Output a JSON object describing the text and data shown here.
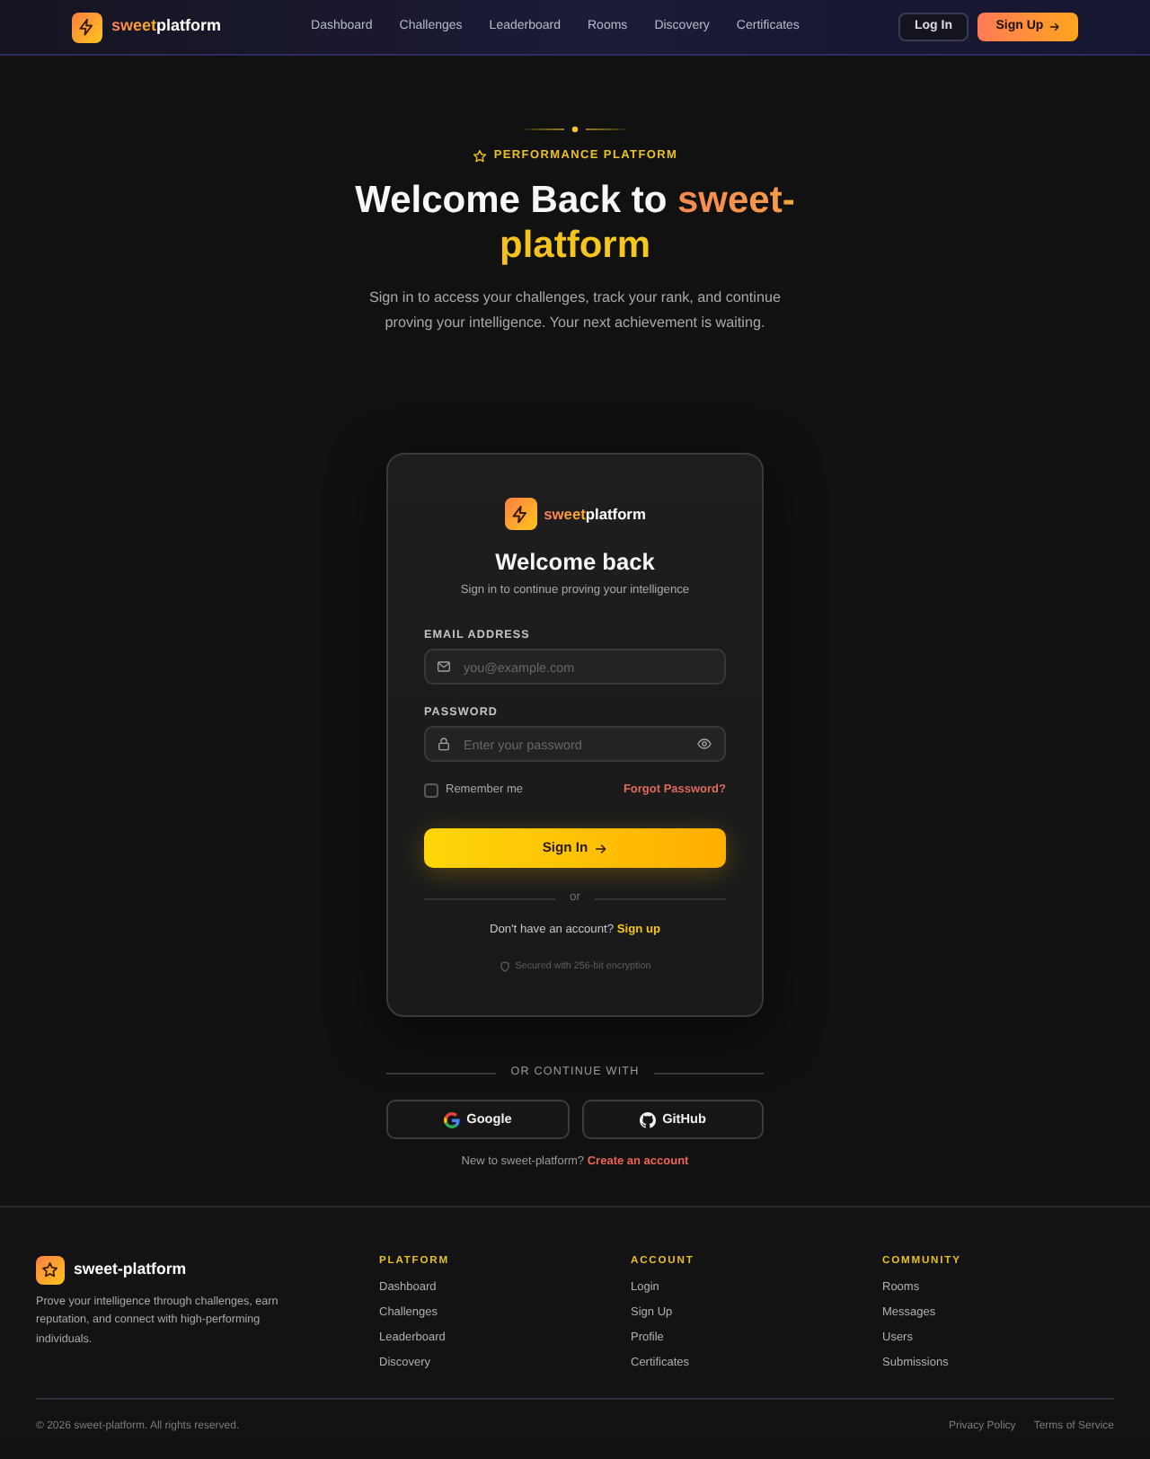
{
  "navbar": {
    "brand": {
      "lead": "sweet",
      "rest": "platform"
    },
    "links": [
      "Dashboard",
      "Challenges",
      "Leaderboard",
      "Rooms",
      "Discovery",
      "Certificates"
    ],
    "login_button": "Log In",
    "signup_button": "Sign Up"
  },
  "hero": {
    "eyebrow": "PERFORMANCE PLATFORM",
    "heading": "Welcome Back to",
    "heading_highlight": "sweet-platform",
    "subtitle": "Sign in to access your challenges, track your rank, and continue proving your intelligence. Your next achievement is waiting."
  },
  "login_card": {
    "brand": {
      "lead": "sweet",
      "rest": "platform"
    },
    "title": "Welcome back",
    "subtitle": "Sign in to continue proving your intelligence",
    "fields": [
      {
        "kind": "email",
        "label": "EMAIL ADDRESS",
        "placeholder": "you@example.com"
      },
      {
        "kind": "password",
        "label": "PASSWORD",
        "placeholder": "Enter your password"
      }
    ],
    "remember_me": {
      "label": "Remember me",
      "checked": false
    },
    "forgot_link": "Forgot Password?",
    "submit_button": "Sign In",
    "divider": "or",
    "signup_prompt": "Don't have an account?",
    "signup_link": "Sign up",
    "security_note": "Secured with 256-bit encryption"
  },
  "social": {
    "divider": "OR CONTINUE WITH",
    "buttons": [
      {
        "kind": "google",
        "label": "Google"
      },
      {
        "kind": "github",
        "label": "GitHub"
      }
    ],
    "prompt": "New to sweet-platform?",
    "link": "Create an account"
  },
  "footer": {
    "brand": "sweet-platform",
    "description": "Prove your intelligence through challenges, earn reputation, and connect with high-performing individuals.",
    "columns": [
      {
        "heading": "PLATFORM",
        "links": [
          "Dashboard",
          "Challenges",
          "Leaderboard",
          "Discovery"
        ]
      },
      {
        "heading": "ACCOUNT",
        "links": [
          "Login",
          "Sign Up",
          "Profile",
          "Certificates"
        ]
      },
      {
        "heading": "COMMUNITY",
        "links": [
          "Rooms",
          "Messages",
          "Users",
          "Submissions"
        ]
      }
    ],
    "copyright": "© 2026 sweet-platform. All rights reserved.",
    "links": [
      "Privacy Policy",
      "Terms of Service"
    ]
  }
}
